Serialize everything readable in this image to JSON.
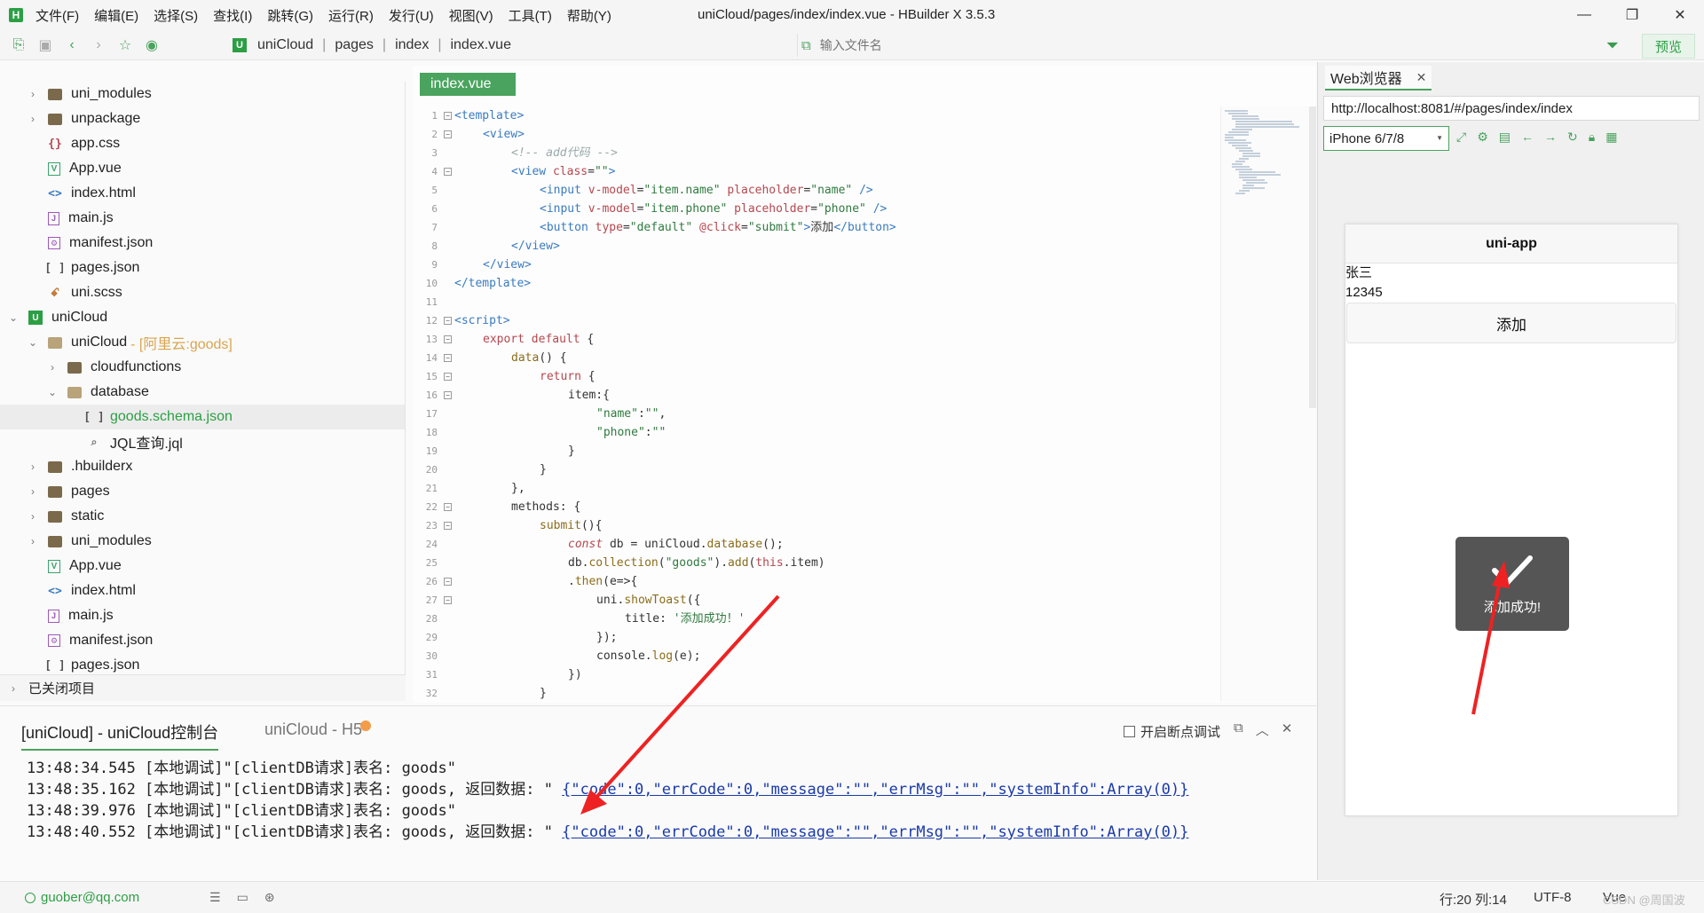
{
  "window": {
    "title": "uniCloud/pages/index/index.vue - HBuilder X 3.5.3",
    "logo_letter": "H",
    "menu": [
      "文件(F)",
      "编辑(E)",
      "选择(S)",
      "查找(I)",
      "跳转(G)",
      "运行(R)",
      "发行(U)",
      "视图(V)",
      "工具(T)",
      "帮助(Y)"
    ]
  },
  "toolbar": {
    "breadcrumbs": [
      "uniCloud",
      "pages",
      "index",
      "index.vue"
    ],
    "file_search_placeholder": "输入文件名",
    "preview_label": "预览"
  },
  "sidebar": {
    "items": [
      {
        "label": "uni_modules",
        "icon": "folder-icon",
        "indent": 1,
        "chevron": "›"
      },
      {
        "label": "unpackage",
        "icon": "folder-icon",
        "indent": 1,
        "chevron": "›"
      },
      {
        "label": "app.css",
        "icon": "css-file-icon",
        "indent": 1,
        "chevron": ""
      },
      {
        "label": "App.vue",
        "icon": "vue-file-icon",
        "indent": 1,
        "chevron": ""
      },
      {
        "label": "index.html",
        "icon": "html-file-icon",
        "indent": 1,
        "chevron": ""
      },
      {
        "label": "main.js",
        "icon": "js-file-icon",
        "indent": 1,
        "chevron": ""
      },
      {
        "label": "manifest.json",
        "icon": "manifest-file-icon",
        "indent": 1,
        "chevron": ""
      },
      {
        "label": "pages.json",
        "icon": "json-file-icon",
        "indent": 1,
        "chevron": ""
      },
      {
        "label": "uni.scss",
        "icon": "scss-file-icon",
        "indent": 1,
        "chevron": ""
      },
      {
        "label": "uniCloud",
        "icon": "unicloud-project-icon",
        "indent": 0,
        "chevron": "⌄"
      },
      {
        "label": "uniCloud",
        "icon": "cloud-folder-icon",
        "indent": 1,
        "chevron": "⌄",
        "tag": "- [阿里云:goods]"
      },
      {
        "label": "cloudfunctions",
        "icon": "folder-icon",
        "indent": 2,
        "chevron": "›"
      },
      {
        "label": "database",
        "icon": "folder-open-icon",
        "indent": 2,
        "chevron": "⌄"
      },
      {
        "label": "goods.schema.json",
        "icon": "json-file-icon",
        "indent": 3,
        "chevron": "",
        "selected": true
      },
      {
        "label": "JQL查询.jql",
        "icon": "jql-file-icon",
        "indent": 3,
        "chevron": ""
      },
      {
        "label": ".hbuilderx",
        "icon": "folder-icon",
        "indent": 1,
        "chevron": "›"
      },
      {
        "label": "pages",
        "icon": "folder-icon",
        "indent": 1,
        "chevron": "›"
      },
      {
        "label": "static",
        "icon": "folder-icon",
        "indent": 1,
        "chevron": "›"
      },
      {
        "label": "uni_modules",
        "icon": "folder-icon",
        "indent": 1,
        "chevron": "›"
      },
      {
        "label": "App.vue",
        "icon": "vue-file-icon",
        "indent": 1,
        "chevron": ""
      },
      {
        "label": "index.html",
        "icon": "html-file-icon",
        "indent": 1,
        "chevron": ""
      },
      {
        "label": "main.js",
        "icon": "js-file-icon",
        "indent": 1,
        "chevron": ""
      },
      {
        "label": "manifest.json",
        "icon": "manifest-file-icon",
        "indent": 1,
        "chevron": ""
      },
      {
        "label": "pages.json",
        "icon": "json-file-icon",
        "indent": 1,
        "chevron": ""
      }
    ],
    "closed_projects_label": "已关闭项目"
  },
  "editor": {
    "tab_label": "index.vue",
    "lines": [
      {
        "n": "1",
        "fold": "⊟",
        "indent": 0,
        "html": "<span class='t-tag'>&lt;template&gt;</span>"
      },
      {
        "n": "2",
        "fold": "⊟",
        "indent": 1,
        "html": "<span class='t-tag'>&lt;view&gt;</span>"
      },
      {
        "n": "3",
        "fold": "",
        "indent": 2,
        "html": "<span class='t-com'>&lt;!-- add代码 --&gt;</span>"
      },
      {
        "n": "4",
        "fold": "⊟",
        "indent": 2,
        "html": "<span class='t-tag'>&lt;view</span> <span class='t-attr'>class</span>=<span class='t-str'>\"\"</span><span class='t-tag'>&gt;</span>"
      },
      {
        "n": "5",
        "fold": "",
        "indent": 3,
        "html": "<span class='t-tag'>&lt;input</span> <span class='t-attr'>v-model</span>=<span class='t-str'>\"item.name\"</span> <span class='t-attr'>placeholder</span>=<span class='t-str'>\"name\"</span> <span class='t-tag'>/&gt;</span>"
      },
      {
        "n": "6",
        "fold": "",
        "indent": 3,
        "html": "<span class='t-tag'>&lt;input</span> <span class='t-attr'>v-model</span>=<span class='t-str'>\"item.phone\"</span> <span class='t-attr'>placeholder</span>=<span class='t-str'>\"phone\"</span> <span class='t-tag'>/&gt;</span>"
      },
      {
        "n": "7",
        "fold": "",
        "indent": 3,
        "html": "<span class='t-tag'>&lt;button</span> <span class='t-attr'>type</span>=<span class='t-str'>\"default\"</span> <span class='t-attr'>@click</span>=<span class='t-str'>\"submit\"</span><span class='t-tag'>&gt;</span>添加<span class='t-tag'>&lt;/button&gt;</span>"
      },
      {
        "n": "8",
        "fold": "",
        "indent": 2,
        "html": "<span class='t-tag'>&lt;/view&gt;</span>"
      },
      {
        "n": "9",
        "fold": "",
        "indent": 1,
        "html": "<span class='t-tag'>&lt;/view&gt;</span>"
      },
      {
        "n": "10",
        "fold": "",
        "indent": 0,
        "html": "<span class='t-tag'>&lt;/template&gt;</span>"
      },
      {
        "n": "11",
        "fold": "",
        "indent": 0,
        "html": ""
      },
      {
        "n": "12",
        "fold": "⊟",
        "indent": 0,
        "html": "<span class='t-tag'>&lt;script&gt;</span>"
      },
      {
        "n": "13",
        "fold": "⊟",
        "indent": 1,
        "html": "<span class='t-kw'>export default</span> {"
      },
      {
        "n": "14",
        "fold": "⊟",
        "indent": 2,
        "html": "<span class='t-fn'>data</span>() {"
      },
      {
        "n": "15",
        "fold": "⊟",
        "indent": 3,
        "html": "<span class='t-kw'>return</span> {"
      },
      {
        "n": "16",
        "fold": "⊟",
        "indent": 4,
        "html": "item:{"
      },
      {
        "n": "17",
        "fold": "",
        "indent": 5,
        "html": "<span class='t-str'>\"name\"</span>:<span class='t-str'>\"\"</span>,"
      },
      {
        "n": "18",
        "fold": "",
        "indent": 5,
        "html": "<span class='t-str'>\"phone\"</span>:<span class='t-str'>\"\"</span>"
      },
      {
        "n": "19",
        "fold": "",
        "indent": 4,
        "html": "}"
      },
      {
        "n": "20",
        "fold": "",
        "indent": 3,
        "html": "}"
      },
      {
        "n": "21",
        "fold": "",
        "indent": 2,
        "html": "},"
      },
      {
        "n": "22",
        "fold": "⊟",
        "indent": 2,
        "html": "methods: {"
      },
      {
        "n": "23",
        "fold": "⊟",
        "indent": 3,
        "html": "<span class='t-fn'>submit</span>(){"
      },
      {
        "n": "24",
        "fold": "",
        "indent": 4,
        "html": "<span class='t-kw'><i>const</i></span> db = uniCloud.<span class='t-fn'>database</span>();"
      },
      {
        "n": "25",
        "fold": "",
        "indent": 4,
        "html": "db.<span class='t-fn'>collection</span>(<span class='t-str'>\"goods\"</span>).<span class='t-fn'>add</span>(<span class='t-kw'>this</span>.item)"
      },
      {
        "n": "26",
        "fold": "⊟",
        "indent": 4,
        "html": ".<span class='t-fn'>then</span>(e=>{"
      },
      {
        "n": "27",
        "fold": "⊟",
        "indent": 5,
        "html": "uni.<span class='t-fn'>showToast</span>({"
      },
      {
        "n": "28",
        "fold": "",
        "indent": 6,
        "html": "title: <span class='t-str'>'添加成功！'</span>"
      },
      {
        "n": "29",
        "fold": "",
        "indent": 5,
        "html": "});"
      },
      {
        "n": "30",
        "fold": "",
        "indent": 5,
        "html": "console.<span class='t-fn'>log</span>(e);"
      },
      {
        "n": "31",
        "fold": "",
        "indent": 4,
        "html": "})"
      },
      {
        "n": "32",
        "fold": "",
        "indent": 3,
        "html": "}"
      }
    ]
  },
  "console": {
    "tab_active": "[uniCloud] - uniCloud控制台",
    "tab_inactive": "uniCloud - H5",
    "breakpoint_label": "开启断点调试",
    "logs": [
      {
        "text": "13:48:34.545 [本地调试]\"[clientDB请求]表名: goods\"",
        "link": ""
      },
      {
        "text": "13:48:35.162 [本地调试]\"[clientDB请求]表名: goods, 返回数据: \" ",
        "link": "{\"code\":0,\"errCode\":0,\"message\":\"\",\"errMsg\":\"\",\"systemInfo\":Array(0)}"
      },
      {
        "text": "13:48:39.976 [本地调试]\"[clientDB请求]表名: goods\"",
        "link": ""
      },
      {
        "text": "13:48:40.552 [本地调试]\"[clientDB请求]表名: goods, 返回数据: \" ",
        "link": "{\"code\":0,\"errCode\":0,\"message\":\"\",\"errMsg\":\"\",\"systemInfo\":Array(0)}"
      }
    ]
  },
  "statusbar": {
    "user": "guober@qq.com",
    "position": "行:20  列:14",
    "encoding": "UTF-8",
    "language": "Vue"
  },
  "watermark": "CSDN @周国波",
  "browser": {
    "tab_label": "Web浏览器",
    "url": "http://localhost:8081/#/pages/index/index",
    "device": "iPhone 6/7/8",
    "phone": {
      "nav_title": "uni-app",
      "name_value": "张三",
      "phone_value": "12345",
      "button_label": "添加",
      "toast_message": "添加成功!"
    }
  },
  "colors": {
    "accent": "#4aa35e",
    "arrow": "#ee2222"
  }
}
